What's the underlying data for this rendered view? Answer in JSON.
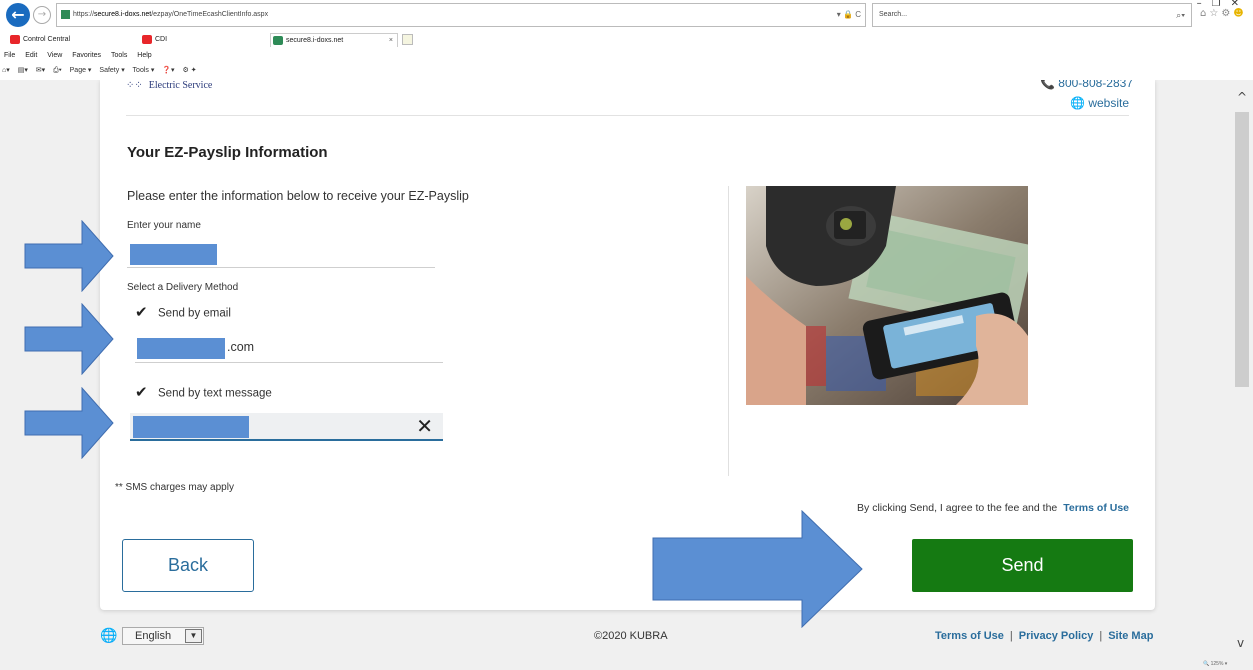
{
  "browser": {
    "url_prefix": "https://",
    "url_host": "secure8.i-doxs.net",
    "url_path": "/ezpay/OneTimeEcashClientInfo.aspx",
    "address_tools": "▾ 🔒 C",
    "search_placeholder": "Search...",
    "tabs": [
      {
        "label": "Control Central"
      },
      {
        "label": "CDI"
      },
      {
        "label": "secure8.i-doxs.net"
      }
    ],
    "menu": [
      "File",
      "Edit",
      "View",
      "Favorites",
      "Tools",
      "Help"
    ],
    "commands": [
      "Page ▾",
      "Safety ▾",
      "Tools ▾"
    ],
    "zoom": "🔍 125%  ▾"
  },
  "header": {
    "logo_text": "Electric Service",
    "phone": "800-808-2837",
    "website_label": "website"
  },
  "form": {
    "title": "Your EZ-Payslip Information",
    "intro": "Please enter the information below to receive your EZ-Payslip",
    "name_label": "Enter your name",
    "delivery_label": "Select a Delivery Method",
    "email_option": "Send by email",
    "email_suffix": ".com",
    "text_option": "Send by text message",
    "sms_note": "** SMS charges may apply",
    "agree_text": "By clicking Send, I agree to the fee and the",
    "terms_link": "Terms of Use",
    "back_label": "Back",
    "send_label": "Send"
  },
  "footer": {
    "language": "English",
    "copyright": "©2020 KUBRA",
    "links": [
      "Terms of Use",
      "Privacy Policy",
      "Site Map"
    ]
  },
  "colors": {
    "accent": "#2a6d9c",
    "send_button": "#157a12",
    "annotation_arrow": "#5b8fd3",
    "redaction": "#5b8fd3"
  }
}
